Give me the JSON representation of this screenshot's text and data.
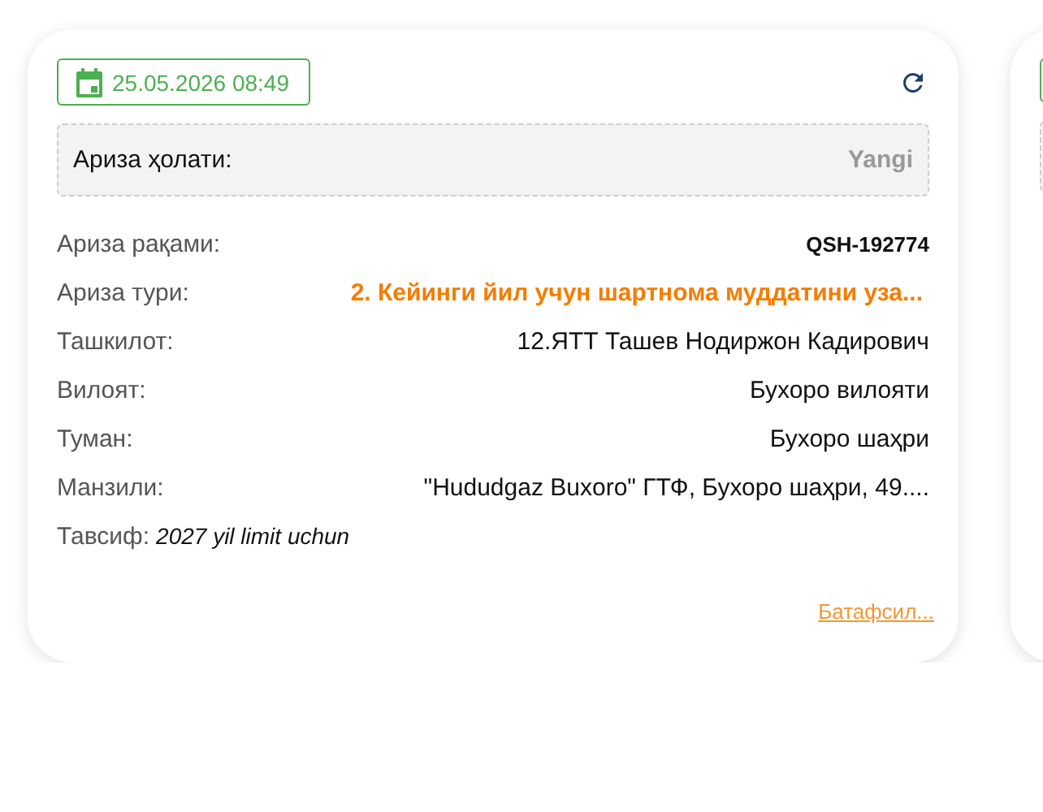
{
  "card": {
    "date": "25.05.2026 08:49",
    "status": {
      "label": "Ариза ҳолати:",
      "value": "Yangi"
    },
    "fields": [
      {
        "label": "Ариза рақами:",
        "value": "QSH-192774",
        "kind": "code"
      },
      {
        "label": "Ариза тури:",
        "value": "2. Кейинги йил учун шартнома муддатини уза...",
        "kind": "accent"
      },
      {
        "label": "Ташкилот:",
        "value": "12.ЯТТ Ташев Нодиржон Кадирович",
        "kind": "plain"
      },
      {
        "label": "Вилоят:",
        "value": "Бухоро вилояти",
        "kind": "plain"
      },
      {
        "label": "Туман:",
        "value": "Бухоро шаҳри",
        "kind": "plain"
      },
      {
        "label": "Манзили:",
        "value": "\"Hududgaz Buxoro\" ГТФ, Бухоро шаҳри, 49....",
        "kind": "plain"
      }
    ],
    "description": {
      "label": "Тавсиф:",
      "value": "2027 yil limit uchun"
    },
    "link": "Батафсил..."
  }
}
